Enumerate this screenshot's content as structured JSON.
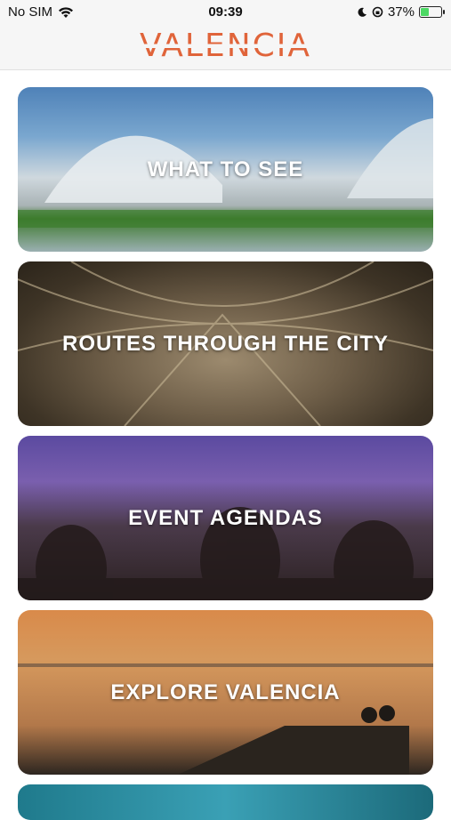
{
  "status_bar": {
    "carrier": "No SIM",
    "time": "09:39",
    "battery": "37%",
    "battery_level": 0.37
  },
  "header": {
    "logo_text": "VALENCIA"
  },
  "cards": [
    {
      "label": "WHAT TO SEE"
    },
    {
      "label": "ROUTES THROUGH THE CITY"
    },
    {
      "label": "EVENT AGENDAS"
    },
    {
      "label": "EXPLORE VALENCIA"
    },
    {
      "label": ""
    }
  ],
  "colors": {
    "brand": "#e0643a",
    "battery_fill": "#4cd964"
  }
}
